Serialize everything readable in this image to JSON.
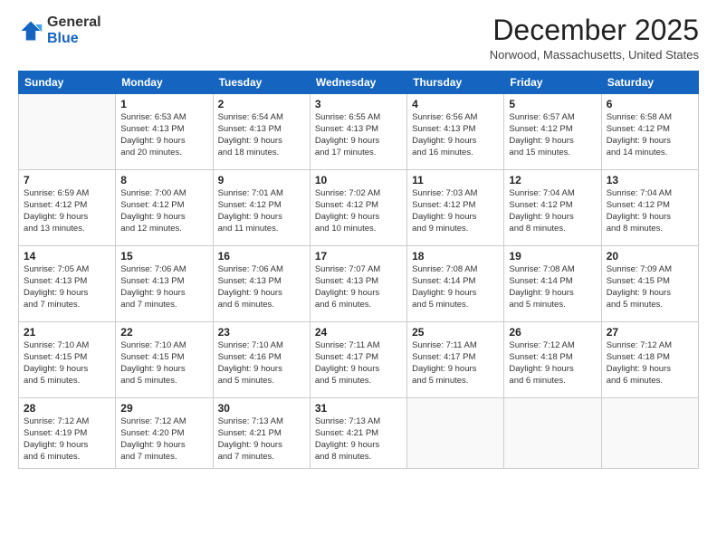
{
  "logo": {
    "general": "General",
    "blue": "Blue"
  },
  "header": {
    "month": "December 2025",
    "location": "Norwood, Massachusetts, United States"
  },
  "weekdays": [
    "Sunday",
    "Monday",
    "Tuesday",
    "Wednesday",
    "Thursday",
    "Friday",
    "Saturday"
  ],
  "weeks": [
    [
      {
        "day": "",
        "info": ""
      },
      {
        "day": "1",
        "info": "Sunrise: 6:53 AM\nSunset: 4:13 PM\nDaylight: 9 hours\nand 20 minutes."
      },
      {
        "day": "2",
        "info": "Sunrise: 6:54 AM\nSunset: 4:13 PM\nDaylight: 9 hours\nand 18 minutes."
      },
      {
        "day": "3",
        "info": "Sunrise: 6:55 AM\nSunset: 4:13 PM\nDaylight: 9 hours\nand 17 minutes."
      },
      {
        "day": "4",
        "info": "Sunrise: 6:56 AM\nSunset: 4:13 PM\nDaylight: 9 hours\nand 16 minutes."
      },
      {
        "day": "5",
        "info": "Sunrise: 6:57 AM\nSunset: 4:12 PM\nDaylight: 9 hours\nand 15 minutes."
      },
      {
        "day": "6",
        "info": "Sunrise: 6:58 AM\nSunset: 4:12 PM\nDaylight: 9 hours\nand 14 minutes."
      }
    ],
    [
      {
        "day": "7",
        "info": "Sunrise: 6:59 AM\nSunset: 4:12 PM\nDaylight: 9 hours\nand 13 minutes."
      },
      {
        "day": "8",
        "info": "Sunrise: 7:00 AM\nSunset: 4:12 PM\nDaylight: 9 hours\nand 12 minutes."
      },
      {
        "day": "9",
        "info": "Sunrise: 7:01 AM\nSunset: 4:12 PM\nDaylight: 9 hours\nand 11 minutes."
      },
      {
        "day": "10",
        "info": "Sunrise: 7:02 AM\nSunset: 4:12 PM\nDaylight: 9 hours\nand 10 minutes."
      },
      {
        "day": "11",
        "info": "Sunrise: 7:03 AM\nSunset: 4:12 PM\nDaylight: 9 hours\nand 9 minutes."
      },
      {
        "day": "12",
        "info": "Sunrise: 7:04 AM\nSunset: 4:12 PM\nDaylight: 9 hours\nand 8 minutes."
      },
      {
        "day": "13",
        "info": "Sunrise: 7:04 AM\nSunset: 4:12 PM\nDaylight: 9 hours\nand 8 minutes."
      }
    ],
    [
      {
        "day": "14",
        "info": "Sunrise: 7:05 AM\nSunset: 4:13 PM\nDaylight: 9 hours\nand 7 minutes."
      },
      {
        "day": "15",
        "info": "Sunrise: 7:06 AM\nSunset: 4:13 PM\nDaylight: 9 hours\nand 7 minutes."
      },
      {
        "day": "16",
        "info": "Sunrise: 7:06 AM\nSunset: 4:13 PM\nDaylight: 9 hours\nand 6 minutes."
      },
      {
        "day": "17",
        "info": "Sunrise: 7:07 AM\nSunset: 4:13 PM\nDaylight: 9 hours\nand 6 minutes."
      },
      {
        "day": "18",
        "info": "Sunrise: 7:08 AM\nSunset: 4:14 PM\nDaylight: 9 hours\nand 5 minutes."
      },
      {
        "day": "19",
        "info": "Sunrise: 7:08 AM\nSunset: 4:14 PM\nDaylight: 9 hours\nand 5 minutes."
      },
      {
        "day": "20",
        "info": "Sunrise: 7:09 AM\nSunset: 4:15 PM\nDaylight: 9 hours\nand 5 minutes."
      }
    ],
    [
      {
        "day": "21",
        "info": "Sunrise: 7:10 AM\nSunset: 4:15 PM\nDaylight: 9 hours\nand 5 minutes."
      },
      {
        "day": "22",
        "info": "Sunrise: 7:10 AM\nSunset: 4:15 PM\nDaylight: 9 hours\nand 5 minutes."
      },
      {
        "day": "23",
        "info": "Sunrise: 7:10 AM\nSunset: 4:16 PM\nDaylight: 9 hours\nand 5 minutes."
      },
      {
        "day": "24",
        "info": "Sunrise: 7:11 AM\nSunset: 4:17 PM\nDaylight: 9 hours\nand 5 minutes."
      },
      {
        "day": "25",
        "info": "Sunrise: 7:11 AM\nSunset: 4:17 PM\nDaylight: 9 hours\nand 5 minutes."
      },
      {
        "day": "26",
        "info": "Sunrise: 7:12 AM\nSunset: 4:18 PM\nDaylight: 9 hours\nand 6 minutes."
      },
      {
        "day": "27",
        "info": "Sunrise: 7:12 AM\nSunset: 4:18 PM\nDaylight: 9 hours\nand 6 minutes."
      }
    ],
    [
      {
        "day": "28",
        "info": "Sunrise: 7:12 AM\nSunset: 4:19 PM\nDaylight: 9 hours\nand 6 minutes."
      },
      {
        "day": "29",
        "info": "Sunrise: 7:12 AM\nSunset: 4:20 PM\nDaylight: 9 hours\nand 7 minutes."
      },
      {
        "day": "30",
        "info": "Sunrise: 7:13 AM\nSunset: 4:21 PM\nDaylight: 9 hours\nand 7 minutes."
      },
      {
        "day": "31",
        "info": "Sunrise: 7:13 AM\nSunset: 4:21 PM\nDaylight: 9 hours\nand 8 minutes."
      },
      {
        "day": "",
        "info": ""
      },
      {
        "day": "",
        "info": ""
      },
      {
        "day": "",
        "info": ""
      }
    ]
  ]
}
